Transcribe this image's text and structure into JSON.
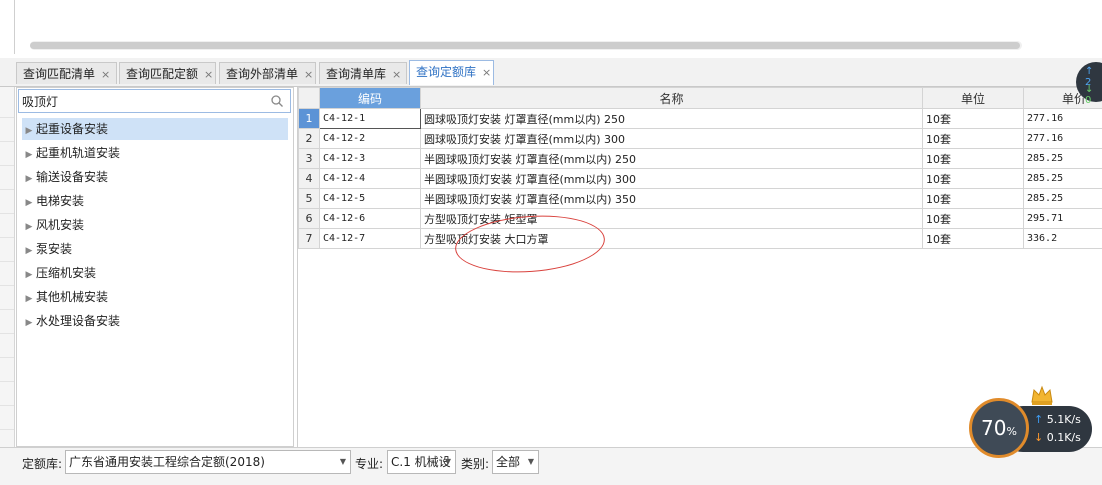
{
  "tabs": [
    {
      "label": "查询匹配清单",
      "active": false
    },
    {
      "label": "查询匹配定额",
      "active": false
    },
    {
      "label": "查询外部清单",
      "active": false
    },
    {
      "label": "查询清单库",
      "active": false
    },
    {
      "label": "查询定额库",
      "active": true
    }
  ],
  "tab_close_glyph": "×",
  "search": {
    "value": "吸顶灯",
    "icon": "search-icon"
  },
  "tree": [
    {
      "label": "起重设备安装",
      "selected": true
    },
    {
      "label": "起重机轨道安装"
    },
    {
      "label": "输送设备安装"
    },
    {
      "label": "电梯安装"
    },
    {
      "label": "风机安装"
    },
    {
      "label": "泵安装"
    },
    {
      "label": "压缩机安装"
    },
    {
      "label": "其他机械安装"
    },
    {
      "label": "水处理设备安装"
    }
  ],
  "table": {
    "headers": {
      "code": "编码",
      "name": "名称",
      "unit": "单位",
      "price": "单价"
    },
    "rows": [
      {
        "num": "1",
        "code": "C4-12-1",
        "name": "圆球吸顶灯安装 灯罩直径(mm以内) 250",
        "unit": "10套",
        "price": "277.16"
      },
      {
        "num": "2",
        "code": "C4-12-2",
        "name": "圆球吸顶灯安装 灯罩直径(mm以内) 300",
        "unit": "10套",
        "price": "277.16"
      },
      {
        "num": "3",
        "code": "C4-12-3",
        "name": "半圆球吸顶灯安装 灯罩直径(mm以内) 250",
        "unit": "10套",
        "price": "285.25"
      },
      {
        "num": "4",
        "code": "C4-12-4",
        "name": "半圆球吸顶灯安装 灯罩直径(mm以内) 300",
        "unit": "10套",
        "price": "285.25"
      },
      {
        "num": "5",
        "code": "C4-12-5",
        "name": "半圆球吸顶灯安装 灯罩直径(mm以内) 350",
        "unit": "10套",
        "price": "285.25"
      },
      {
        "num": "6",
        "code": "C4-12-6",
        "name": "方型吸顶灯安装 矩型罩",
        "unit": "10套",
        "price": "295.71"
      },
      {
        "num": "7",
        "code": "C4-12-7",
        "name": "方型吸顶灯安装 大口方罩",
        "unit": "10套",
        "price": "336.2"
      }
    ]
  },
  "bottom": {
    "quota_label": "定额库:",
    "quota_value": "广东省通用安装工程综合定额(2018)",
    "major_label": "专业:",
    "major_value": "C.1 机械设",
    "category_label": "类别:",
    "category_value": "全部"
  },
  "net": {
    "percent": "70",
    "percent_sign": "%",
    "up": "5.1K/s",
    "down": "0.1K/s"
  },
  "side_net": {
    "up": "2",
    "down": "0"
  },
  "colors": {
    "accent": "#2f72c4",
    "header_selected": "#6aa0dd",
    "annotation": "#d9423d",
    "widget_ring": "#e08b2b"
  }
}
